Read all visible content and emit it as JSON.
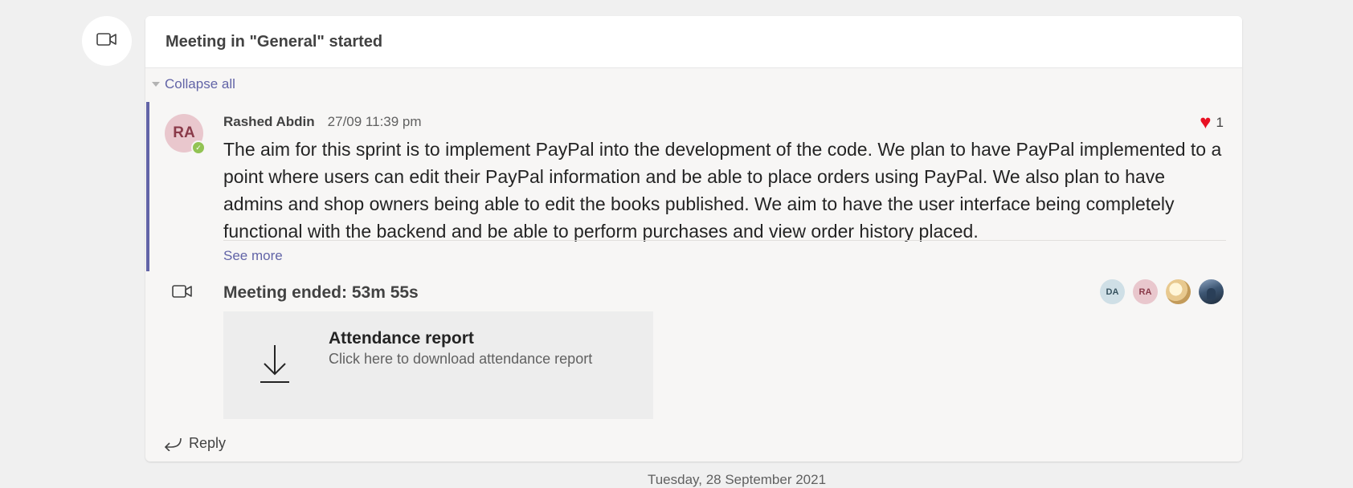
{
  "meeting": {
    "title": "Meeting in \"General\" started",
    "collapse_label": "Collapse all",
    "icon": "video-camera-icon"
  },
  "message": {
    "author_initials": "RA",
    "author": "Rashed Abdin",
    "timestamp": "27/09 11:39 pm",
    "reaction": {
      "icon": "heart-icon",
      "count": "1"
    },
    "body": "The aim for this sprint is to implement PayPal into the development of the code. We plan to have PayPal implemented to a point where users can edit their PayPal information and be able to place orders using PayPal. We also plan to have admins and shop owners being able to edit the books published. We aim to have the user interface being completely functional with the backend and be able to perform purchases and view order history placed.",
    "see_more": "See more"
  },
  "meeting_ended": {
    "label": "Meeting ended: 53m 55s",
    "participants": [
      {
        "initials": "DA"
      },
      {
        "initials": "RA"
      },
      {
        "initials": ""
      },
      {
        "initials": ""
      }
    ]
  },
  "attendance": {
    "title": "Attendance report",
    "subtitle": "Click here to download attendance report",
    "icon": "download-icon"
  },
  "reply_label": "Reply",
  "next_date": "Tuesday, 28 September 2021",
  "colors": {
    "accent": "#6264a7",
    "heart": "#e81123",
    "presence": "#92c353",
    "background": "#f0f0f0"
  }
}
